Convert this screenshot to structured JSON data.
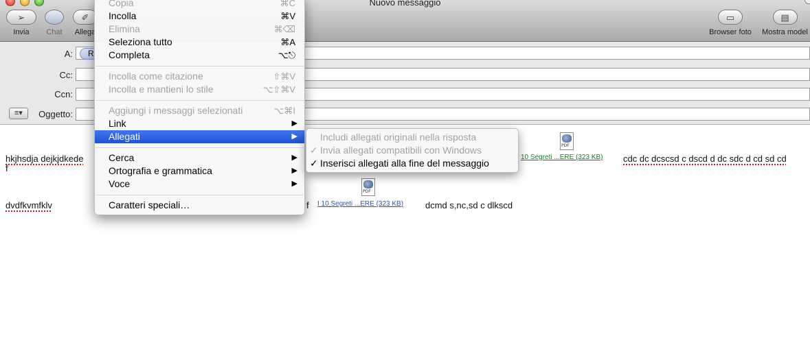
{
  "window": {
    "title": "Nuovo messaggio"
  },
  "toolbar": {
    "send_label": "Invia",
    "chat_label": "Chat",
    "attach_label": "Allega",
    "photo_browser_label": "Browser foto",
    "show_templates_label": "Mostra model"
  },
  "headers": {
    "to_label": "A:",
    "to_token": "R",
    "cc_label": "Cc:",
    "bcc_label": "Ccn:",
    "subject_label": "Oggetto:",
    "account_button": "≡▾"
  },
  "body": {
    "line1_start": "hkjhsdja dejkjdkede",
    "line1_wrap": "f",
    "line1_end": "cdc dc  dcscsd c dscd d dc sdc d cd sd cd",
    "line2_start": "dvdfkvmfklv",
    "line2_mid": "f",
    "line2_end": "dcmd s,nc,sd c dlkscd",
    "attachment1": "10 Segreti ...ERE  (323 KB)",
    "attachment2": "I 10 Segreti ...ERE  (323 KB)",
    "pdf_tag": "PDF"
  },
  "menu": {
    "items": [
      {
        "label": "Copia",
        "shortcut": "⌘C",
        "enabled": false
      },
      {
        "label": "Incolla",
        "shortcut": "⌘V",
        "enabled": true
      },
      {
        "label": "Elimina",
        "shortcut": "⌘⌫",
        "enabled": false
      },
      {
        "label": "Seleziona tutto",
        "shortcut": "⌘A",
        "enabled": true
      },
      {
        "label": "Completa",
        "shortcut": "⌥⎋",
        "enabled": true
      },
      {
        "label": "Incolla come citazione",
        "shortcut": "⇧⌘V",
        "enabled": false
      },
      {
        "label": "Incolla e mantieni lo stile",
        "shortcut": "⌥⇧⌘V",
        "enabled": false
      },
      {
        "label": "Aggiungi i messaggi selezionati",
        "shortcut": "⌥⌘I",
        "enabled": false
      },
      {
        "label": "Link",
        "submenu": true,
        "enabled": true
      },
      {
        "label": "Allegati",
        "submenu": true,
        "enabled": true,
        "selected": true
      },
      {
        "label": "Cerca",
        "submenu": true,
        "enabled": true
      },
      {
        "label": "Ortografia e grammatica",
        "submenu": true,
        "enabled": true
      },
      {
        "label": "Voce",
        "submenu": true,
        "enabled": true
      },
      {
        "label": "Caratteri speciali…",
        "enabled": true
      }
    ],
    "arrow": "▶"
  },
  "submenu": {
    "items": [
      {
        "label": "Includi allegati originali nella risposta",
        "checked": false,
        "enabled": false
      },
      {
        "label": "Invia allegati compatibili con Windows",
        "checked": true,
        "enabled": false
      },
      {
        "label": "Inserisci allegati alla fine del messaggio",
        "checked": true,
        "enabled": true
      }
    ],
    "check": "✓"
  },
  "colors": {
    "menu_selection": "#1e52d8",
    "spelling_underline": "#d0141e",
    "attachment_link_green": "#1b7a25",
    "attachment_link_blue": "#2a56a8"
  },
  "icons": [
    "close-icon",
    "minimize-icon",
    "zoom-icon",
    "send-icon",
    "chat-icon",
    "paperclip-icon",
    "photo-browser-icon",
    "templates-icon",
    "pdf-icon",
    "submenu-arrow-icon",
    "checkmark-icon"
  ]
}
